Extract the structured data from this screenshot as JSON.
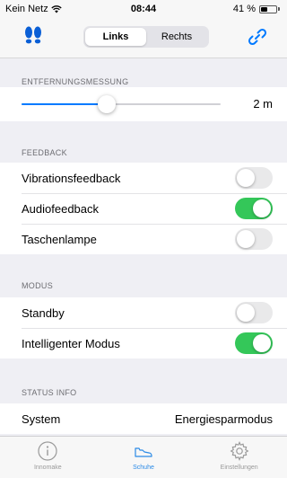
{
  "status_bar": {
    "carrier": "Kein Netz",
    "time": "08:44",
    "battery_percent": "41 %",
    "battery_level": 0.41
  },
  "nav": {
    "segments": [
      "Links",
      "Rechts"
    ],
    "active_segment": 0,
    "left_icon": "footprints-icon",
    "right_icon": "link-icon",
    "accent_color": "#007aff"
  },
  "distance": {
    "header": "ENTFERNUNGSMESSUNG",
    "value_label": "2 m",
    "slider_fraction": 0.43
  },
  "feedback": {
    "header": "FEEDBACK",
    "items": [
      {
        "label": "Vibrationsfeedback",
        "on": false
      },
      {
        "label": "Audiofeedback",
        "on": true
      },
      {
        "label": "Taschenlampe",
        "on": false
      }
    ]
  },
  "modus": {
    "header": "MODUS",
    "items": [
      {
        "label": "Standby",
        "on": false
      },
      {
        "label": "Intelligenter Modus",
        "on": true
      }
    ]
  },
  "status_info": {
    "header": "STATUS INFO",
    "label": "System",
    "value": "Energiesparmodus"
  },
  "tabs": [
    {
      "label": "Innomake",
      "icon": "info-icon",
      "active": false
    },
    {
      "label": "Schuhe",
      "icon": "shoe-icon",
      "active": true
    },
    {
      "label": "Einstellungen",
      "icon": "gear-icon",
      "active": false
    }
  ],
  "colors": {
    "switch_on": "#34c759",
    "tab_active": "#2b8ae6"
  }
}
